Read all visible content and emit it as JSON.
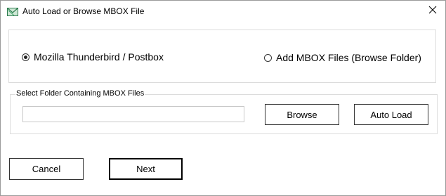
{
  "window": {
    "title": "Auto Load or Browse MBOX File",
    "app_icon": "green-envelope-icon",
    "close_icon": "close-icon"
  },
  "source_options": [
    {
      "label": "Mozilla Thunderbird / Postbox",
      "selected": true
    },
    {
      "label": "Add MBOX Files (Browse Folder)",
      "selected": false
    }
  ],
  "folder_group": {
    "legend": "Select Folder Containing MBOX Files",
    "path_value": "",
    "browse_label": "Browse",
    "auto_load_label": "Auto Load"
  },
  "footer": {
    "cancel_label": "Cancel",
    "next_label": "Next"
  },
  "colors": {
    "border_light": "#dcdcdc",
    "button_border": "#333333",
    "icon_green": "#2e7d4f"
  }
}
